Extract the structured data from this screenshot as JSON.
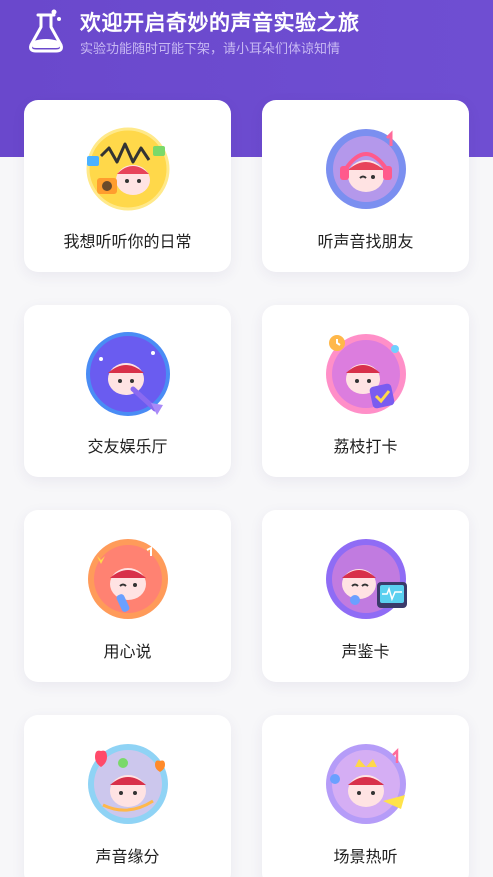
{
  "header": {
    "title": "欢迎开启奇妙的声音实验之旅",
    "subtitle": "实验功能随时可能下架，请小耳朵们体谅知情",
    "icon": "flask-icon"
  },
  "cards": [
    {
      "label": "我想听听你的日常",
      "icon": "soundwave-mascot-icon",
      "color": "#ffd84a"
    },
    {
      "label": "听声音找朋友",
      "icon": "headphones-mascot-icon",
      "color": "#7b8ff0"
    },
    {
      "label": "交友娱乐厅",
      "icon": "guitar-mascot-icon",
      "color": "#6a5cf0"
    },
    {
      "label": "荔枝打卡",
      "icon": "clock-checkin-mascot-icon",
      "color": "#ff8fc8"
    },
    {
      "label": "用心说",
      "icon": "mic-mascot-icon",
      "color": "#ff9b5a"
    },
    {
      "label": "声鉴卡",
      "icon": "monitor-mascot-icon",
      "color": "#8f6cf5"
    },
    {
      "label": "声音缘分",
      "icon": "cupid-mascot-icon",
      "color": "#8fd3f5"
    },
    {
      "label": "场景热听",
      "icon": "crown-mascot-icon",
      "color": "#b59cf8"
    }
  ]
}
